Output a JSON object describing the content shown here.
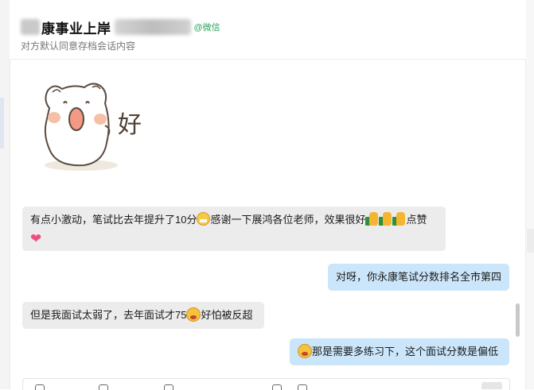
{
  "header": {
    "title": "康事业上岸",
    "channel_tag": "@微信",
    "subtitle": "对方默认同意存档会话内容"
  },
  "sticker": {
    "caption": "好"
  },
  "messages": [
    {
      "direction": "received",
      "parts": {
        "t1": "有点小激动，笔试比去年提升了10分",
        "t2": "感谢一下展鸿各位老师，效果很好",
        "t3": "点赞"
      }
    },
    {
      "direction": "sent",
      "text": "对呀，你永康笔试分数排名全市第四"
    },
    {
      "direction": "received",
      "parts": {
        "t1": "但是我面试太弱了，去年面试才75",
        "t2": "好怕被反超"
      }
    },
    {
      "direction": "sent",
      "text": "那是需要多练习下，这个面试分数是偏低"
    }
  ],
  "icons": {
    "grin": "grin-emoji-icon",
    "thumbs": "thumbs-up-emoji-icon",
    "heart": "heart-emoji-icon",
    "cry": "crying-laugh-emoji-icon"
  },
  "colors": {
    "received_bubble": "#ececec",
    "sent_bubble": "#cbe6fb",
    "wechat_green": "#2aa35a"
  }
}
